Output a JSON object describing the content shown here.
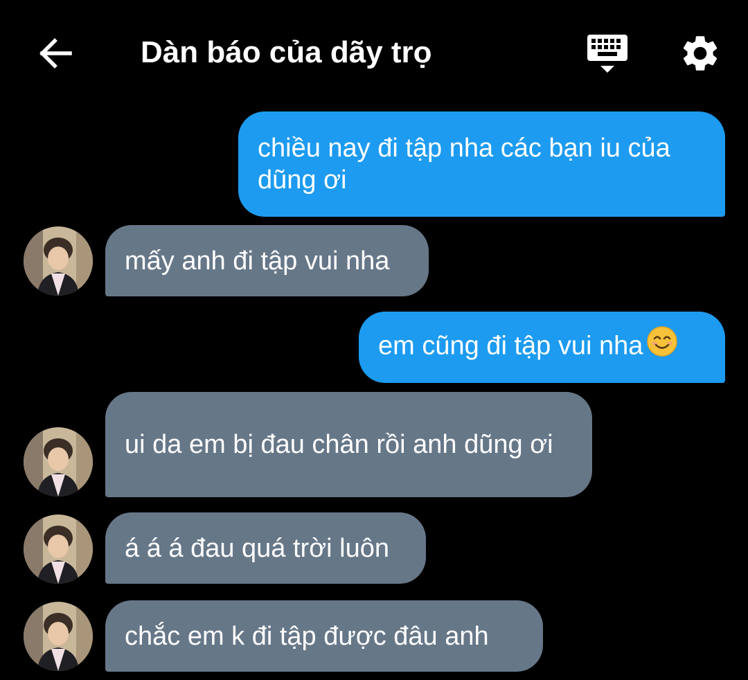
{
  "header": {
    "title": "Dàn báo của dãy trọ",
    "back_icon": "arrow-left-icon",
    "keyboard_icon": "keyboard-icon",
    "settings_icon": "gear-icon"
  },
  "colors": {
    "background": "#000000",
    "outgoing_bubble": "#1d9bf0",
    "incoming_bubble": "#667788",
    "text": "#ffffff"
  },
  "messages": [
    {
      "direction": "outgoing",
      "text": "chiều nay đi tập nha các bạn iu của dũng ơi"
    },
    {
      "direction": "incoming",
      "text": "mấy anh đi tập vui nha"
    },
    {
      "direction": "outgoing",
      "text": "em cũng đi tập vui nha",
      "emoji": "smiling-face-emoji"
    },
    {
      "direction": "incoming",
      "text": "ui da em bị đau chân rồi anh dũng ơi"
    },
    {
      "direction": "incoming",
      "text": "á á á đau quá trời luôn"
    },
    {
      "direction": "incoming",
      "text": "chắc em k đi tập được đâu anh"
    }
  ]
}
